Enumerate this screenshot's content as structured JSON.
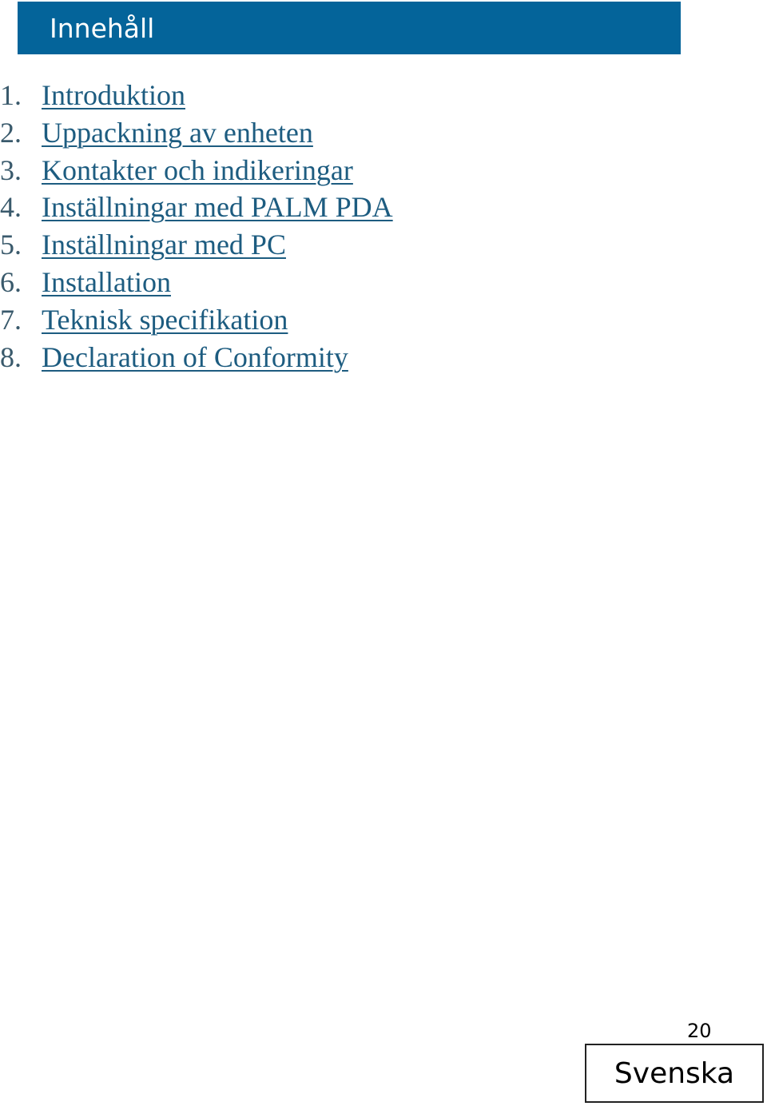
{
  "header": {
    "title": "Innehåll",
    "bar_color": "#04649a"
  },
  "toc": {
    "link_color": "#1d5c80",
    "items": [
      {
        "number": "1.",
        "label": "Introduktion"
      },
      {
        "number": "2.",
        "label": "Uppackning av enheten"
      },
      {
        "number": "3.",
        "label": "Kontakter och indikeringar"
      },
      {
        "number": "4.",
        "label": "Inställningar med PALM PDA"
      },
      {
        "number": "5.",
        "label": "Inställningar med PC"
      },
      {
        "number": "6.",
        "label": "Installation"
      },
      {
        "number": "7.",
        "label": "Teknisk specifikation"
      },
      {
        "number": "8.",
        "label": "Declaration of Conformity"
      }
    ]
  },
  "footer": {
    "page_number": "20",
    "language": "Svenska"
  }
}
